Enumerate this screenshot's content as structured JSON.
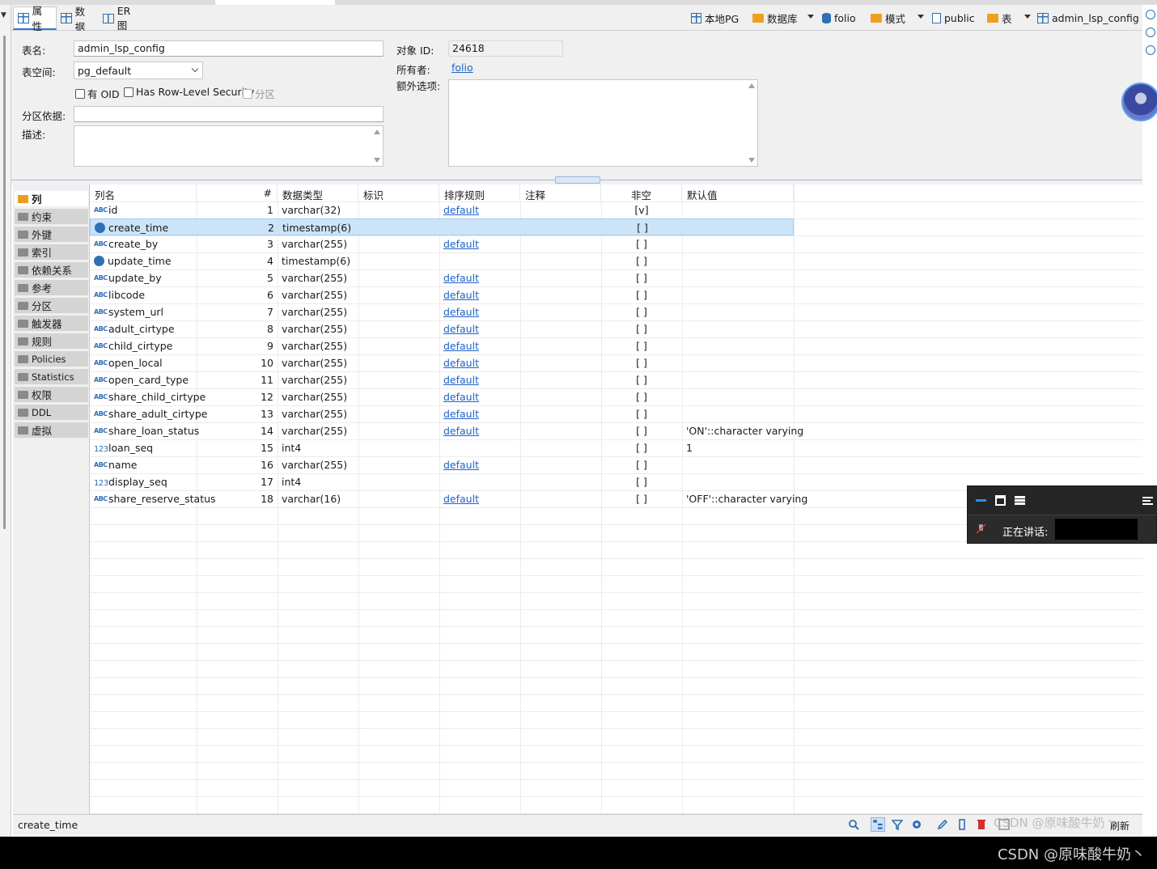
{
  "editor_tabs": [
    {
      "label": "属性",
      "icon": "table-properties-icon",
      "active": true
    },
    {
      "label": "数据",
      "icon": "data-grid-icon",
      "active": false
    },
    {
      "label": "ER 图",
      "icon": "er-diagram-icon",
      "active": false
    }
  ],
  "breadcrumb": [
    {
      "label": "本地PG",
      "icon": "connection-icon"
    },
    {
      "label": "数据库",
      "icon": "database-folder-icon"
    },
    {
      "label": "folio",
      "icon": "database-icon"
    },
    {
      "label": "模式",
      "icon": "schema-folder-icon"
    },
    {
      "label": "public",
      "icon": "schema-icon"
    },
    {
      "label": "表",
      "icon": "tables-folder-icon"
    },
    {
      "label": "admin_lsp_config",
      "icon": "table-icon"
    }
  ],
  "properties": {
    "table_name_label": "表名:",
    "table_name": "admin_lsp_config",
    "tablespace_label": "表空间:",
    "tablespace": "pg_default",
    "has_oid_label": "有 OID",
    "row_level_security_label": "Has Row-Level Security",
    "partition_label": "分区",
    "partition_by_label": "分区依据:",
    "partition_by": "",
    "description_label": "描述:",
    "description": "",
    "object_id_label": "对象 ID:",
    "object_id": "24618",
    "owner_label": "所有者:",
    "owner": "folio",
    "extra_options_label": "额外选项:",
    "extra_options": ""
  },
  "side_nav": [
    {
      "label": "列",
      "icon": "columns-icon",
      "active": true
    },
    {
      "label": "约束",
      "icon": "constraints-icon"
    },
    {
      "label": "外键",
      "icon": "foreign-keys-icon"
    },
    {
      "label": "索引",
      "icon": "indexes-icon"
    },
    {
      "label": "依赖关系",
      "icon": "dependencies-icon"
    },
    {
      "label": "参考",
      "icon": "references-icon"
    },
    {
      "label": "分区",
      "icon": "partitions-icon"
    },
    {
      "label": "触发器",
      "icon": "triggers-icon"
    },
    {
      "label": "规则",
      "icon": "rules-icon"
    },
    {
      "label": "Policies",
      "icon": "policies-icon"
    },
    {
      "label": "Statistics",
      "icon": "statistics-icon"
    },
    {
      "label": "权限",
      "icon": "permissions-icon"
    },
    {
      "label": "DDL",
      "icon": "ddl-icon"
    },
    {
      "label": "虚拟",
      "icon": "virtual-icon"
    }
  ],
  "columns_grid": {
    "headers": [
      "列名",
      "#",
      "数据类型",
      "标识",
      "排序规则",
      "注释",
      "非空",
      "默认值"
    ],
    "rows": [
      {
        "type_icon": "ABC",
        "name": "id",
        "num": "1",
        "data_type": "varchar(32)",
        "identity": "",
        "collation": "default",
        "comment": "",
        "not_null": "[v]",
        "default": ""
      },
      {
        "type_icon": "clock",
        "name": "create_time",
        "num": "2",
        "data_type": "timestamp(6)",
        "identity": "",
        "collation": "",
        "comment": "",
        "not_null": "[ ]",
        "default": "",
        "selected": true
      },
      {
        "type_icon": "ABC",
        "name": "create_by",
        "num": "3",
        "data_type": "varchar(255)",
        "identity": "",
        "collation": "default",
        "comment": "",
        "not_null": "[ ]",
        "default": ""
      },
      {
        "type_icon": "clock",
        "name": "update_time",
        "num": "4",
        "data_type": "timestamp(6)",
        "identity": "",
        "collation": "",
        "comment": "",
        "not_null": "[ ]",
        "default": ""
      },
      {
        "type_icon": "ABC",
        "name": "update_by",
        "num": "5",
        "data_type": "varchar(255)",
        "identity": "",
        "collation": "default",
        "comment": "",
        "not_null": "[ ]",
        "default": ""
      },
      {
        "type_icon": "ABC",
        "name": "libcode",
        "num": "6",
        "data_type": "varchar(255)",
        "identity": "",
        "collation": "default",
        "comment": "",
        "not_null": "[ ]",
        "default": ""
      },
      {
        "type_icon": "ABC",
        "name": "system_url",
        "num": "7",
        "data_type": "varchar(255)",
        "identity": "",
        "collation": "default",
        "comment": "",
        "not_null": "[ ]",
        "default": ""
      },
      {
        "type_icon": "ABC",
        "name": "adult_cirtype",
        "num": "8",
        "data_type": "varchar(255)",
        "identity": "",
        "collation": "default",
        "comment": "",
        "not_null": "[ ]",
        "default": ""
      },
      {
        "type_icon": "ABC",
        "name": "child_cirtype",
        "num": "9",
        "data_type": "varchar(255)",
        "identity": "",
        "collation": "default",
        "comment": "",
        "not_null": "[ ]",
        "default": ""
      },
      {
        "type_icon": "ABC",
        "name": "open_local",
        "num": "10",
        "data_type": "varchar(255)",
        "identity": "",
        "collation": "default",
        "comment": "",
        "not_null": "[ ]",
        "default": ""
      },
      {
        "type_icon": "ABC",
        "name": "open_card_type",
        "num": "11",
        "data_type": "varchar(255)",
        "identity": "",
        "collation": "default",
        "comment": "",
        "not_null": "[ ]",
        "default": ""
      },
      {
        "type_icon": "ABC",
        "name": "share_child_cirtype",
        "num": "12",
        "data_type": "varchar(255)",
        "identity": "",
        "collation": "default",
        "comment": "",
        "not_null": "[ ]",
        "default": ""
      },
      {
        "type_icon": "ABC",
        "name": "share_adult_cirtype",
        "num": "13",
        "data_type": "varchar(255)",
        "identity": "",
        "collation": "default",
        "comment": "",
        "not_null": "[ ]",
        "default": ""
      },
      {
        "type_icon": "ABC",
        "name": "share_loan_status",
        "num": "14",
        "data_type": "varchar(255)",
        "identity": "",
        "collation": "default",
        "comment": "",
        "not_null": "[ ]",
        "default": "'ON'::character varying"
      },
      {
        "type_icon": "123",
        "name": "loan_seq",
        "num": "15",
        "data_type": "int4",
        "identity": "",
        "collation": "",
        "comment": "",
        "not_null": "[ ]",
        "default": "1"
      },
      {
        "type_icon": "ABC",
        "name": "name",
        "num": "16",
        "data_type": "varchar(255)",
        "identity": "",
        "collation": "default",
        "comment": "",
        "not_null": "[ ]",
        "default": ""
      },
      {
        "type_icon": "123",
        "name": "display_seq",
        "num": "17",
        "data_type": "int4",
        "identity": "",
        "collation": "",
        "comment": "",
        "not_null": "[ ]",
        "default": ""
      },
      {
        "type_icon": "ABC",
        "name": "share_reserve_status",
        "num": "18",
        "data_type": "varchar(16)",
        "identity": "",
        "collation": "default",
        "comment": "",
        "not_null": "[ ]",
        "default": "'OFF'::character varying"
      }
    ]
  },
  "status_bar": {
    "selected_text": "create_time",
    "save_label": "刷新"
  },
  "overlay": {
    "speaking_label": "正在讲话:"
  },
  "watermark": "CSDN @原味酸牛奶丶",
  "colors": {
    "accent": "#2a7bd6",
    "selection": "#cce4f7",
    "link": "#1e62c8",
    "folder": "#e8a33a"
  }
}
